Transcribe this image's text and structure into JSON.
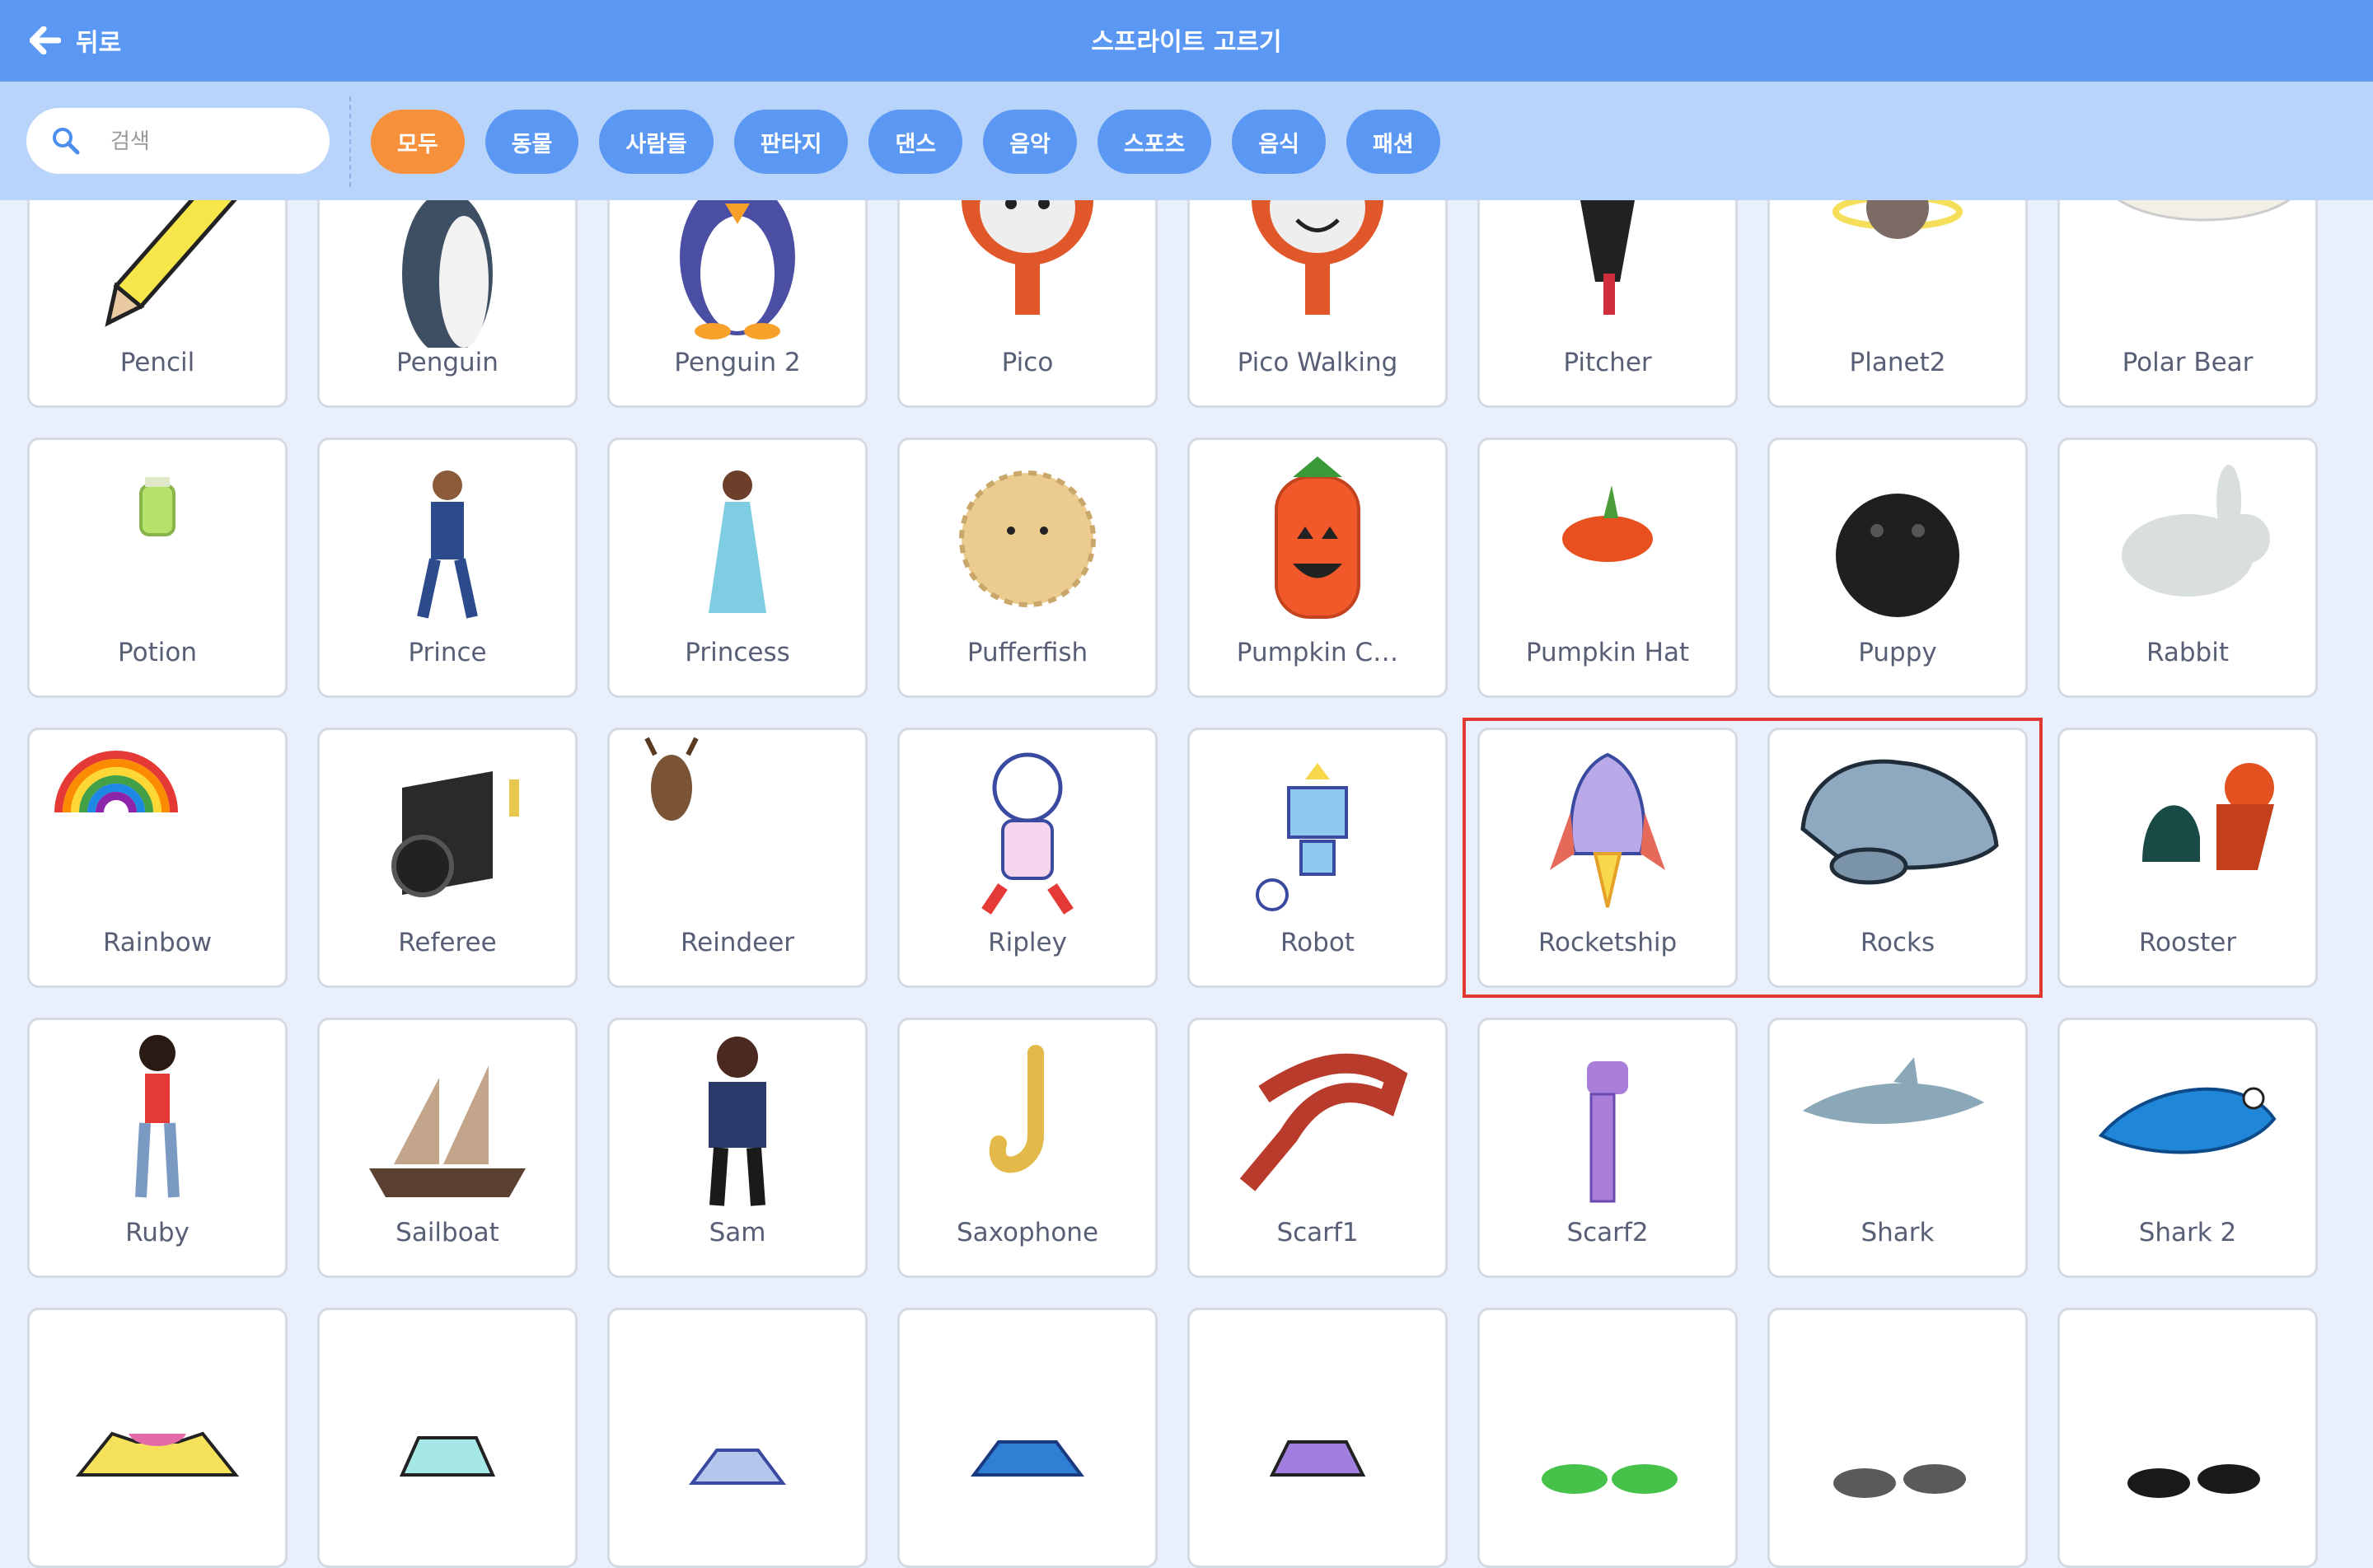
{
  "header": {
    "back_label": "뒤로",
    "title": "스프라이트 고르기"
  },
  "search": {
    "placeholder": "검색"
  },
  "categories": [
    {
      "label": "모두",
      "active": true
    },
    {
      "label": "동물",
      "active": false
    },
    {
      "label": "사람들",
      "active": false
    },
    {
      "label": "판타지",
      "active": false
    },
    {
      "label": "댄스",
      "active": false
    },
    {
      "label": "음악",
      "active": false
    },
    {
      "label": "스포츠",
      "active": false
    },
    {
      "label": "음식",
      "active": false
    },
    {
      "label": "패션",
      "active": false
    }
  ],
  "sprites": [
    {
      "name": "Pencil",
      "icon": "pencil-icon"
    },
    {
      "name": "Penguin",
      "icon": "penguin-icon"
    },
    {
      "name": "Penguin 2",
      "icon": "penguin-2-icon"
    },
    {
      "name": "Pico",
      "icon": "pico-icon"
    },
    {
      "name": "Pico Walking",
      "icon": "pico-walking-icon"
    },
    {
      "name": "Pitcher",
      "icon": "pitcher-icon"
    },
    {
      "name": "Planet2",
      "icon": "planet-icon"
    },
    {
      "name": "Polar Bear",
      "icon": "polar-bear-icon"
    },
    {
      "name": "Potion",
      "icon": "potion-icon"
    },
    {
      "name": "Prince",
      "icon": "prince-icon"
    },
    {
      "name": "Princess",
      "icon": "princess-icon"
    },
    {
      "name": "Pufferfish",
      "icon": "pufferfish-icon"
    },
    {
      "name": "Pumpkin C…",
      "icon": "pumpkin-costume-icon"
    },
    {
      "name": "Pumpkin Hat",
      "icon": "pumpkin-hat-icon"
    },
    {
      "name": "Puppy",
      "icon": "puppy-icon"
    },
    {
      "name": "Rabbit",
      "icon": "rabbit-icon"
    },
    {
      "name": "Rainbow",
      "icon": "rainbow-icon"
    },
    {
      "name": "Referee",
      "icon": "referee-icon"
    },
    {
      "name": "Reindeer",
      "icon": "reindeer-icon"
    },
    {
      "name": "Ripley",
      "icon": "ripley-icon"
    },
    {
      "name": "Robot",
      "icon": "robot-icon"
    },
    {
      "name": "Rocketship",
      "icon": "rocketship-icon",
      "highlighted": true
    },
    {
      "name": "Rocks",
      "icon": "rocks-icon",
      "highlighted": true
    },
    {
      "name": "Rooster",
      "icon": "rooster-icon"
    },
    {
      "name": "Ruby",
      "icon": "ruby-icon"
    },
    {
      "name": "Sailboat",
      "icon": "sailboat-icon"
    },
    {
      "name": "Sam",
      "icon": "sam-icon"
    },
    {
      "name": "Saxophone",
      "icon": "saxophone-icon"
    },
    {
      "name": "Scarf1",
      "icon": "scarf1-icon"
    },
    {
      "name": "Scarf2",
      "icon": "scarf2-icon"
    },
    {
      "name": "Shark",
      "icon": "shark-icon"
    },
    {
      "name": "Shark 2",
      "icon": "shark-2-icon"
    },
    {
      "name": "",
      "icon": "shirt-icon"
    },
    {
      "name": "",
      "icon": "blouse-icon"
    },
    {
      "name": "",
      "icon": "shirt-collar-icon"
    },
    {
      "name": "",
      "icon": "sweater-icon"
    },
    {
      "name": "",
      "icon": "purple-shirt-icon"
    },
    {
      "name": "",
      "icon": "green-sneakers-icon"
    },
    {
      "name": "",
      "icon": "gray-shoes-icon"
    },
    {
      "name": "",
      "icon": "black-sneakers-icon"
    }
  ],
  "colors": {
    "header": "#5b98f3",
    "filter_bar": "#b9d4fb",
    "active_chip": "#f7903b",
    "highlight": "#e0392f"
  }
}
